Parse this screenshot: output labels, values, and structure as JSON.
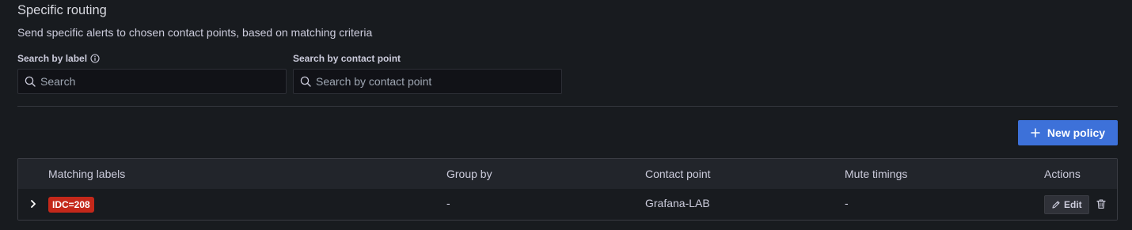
{
  "section": {
    "title": "Specific routing",
    "description": "Send specific alerts to chosen contact points, based on matching criteria"
  },
  "filters": {
    "label_search": {
      "label": "Search by label",
      "value": "",
      "placeholder": "Search"
    },
    "contact_search": {
      "label": "Search by contact point",
      "value": "",
      "placeholder": "Search by contact point"
    }
  },
  "actions": {
    "new_policy_label": "New policy"
  },
  "table": {
    "columns": [
      "Matching labels",
      "Group by",
      "Contact point",
      "Mute timings",
      "Actions"
    ],
    "rows": [
      {
        "matcher": "IDC=208",
        "group_by": "-",
        "contact_point": "Grafana-LAB",
        "mute_timings": "-",
        "edit_label": "Edit"
      }
    ]
  },
  "colors": {
    "background": "#181b1f",
    "primary_button": "#3d71d9",
    "label_badge": "#c4281a"
  },
  "icons": {
    "info": "info-circle-icon",
    "search": "search-icon",
    "plus": "plus-icon",
    "expand": "chevron-right-icon",
    "edit": "pen-icon",
    "delete": "trash-icon"
  }
}
